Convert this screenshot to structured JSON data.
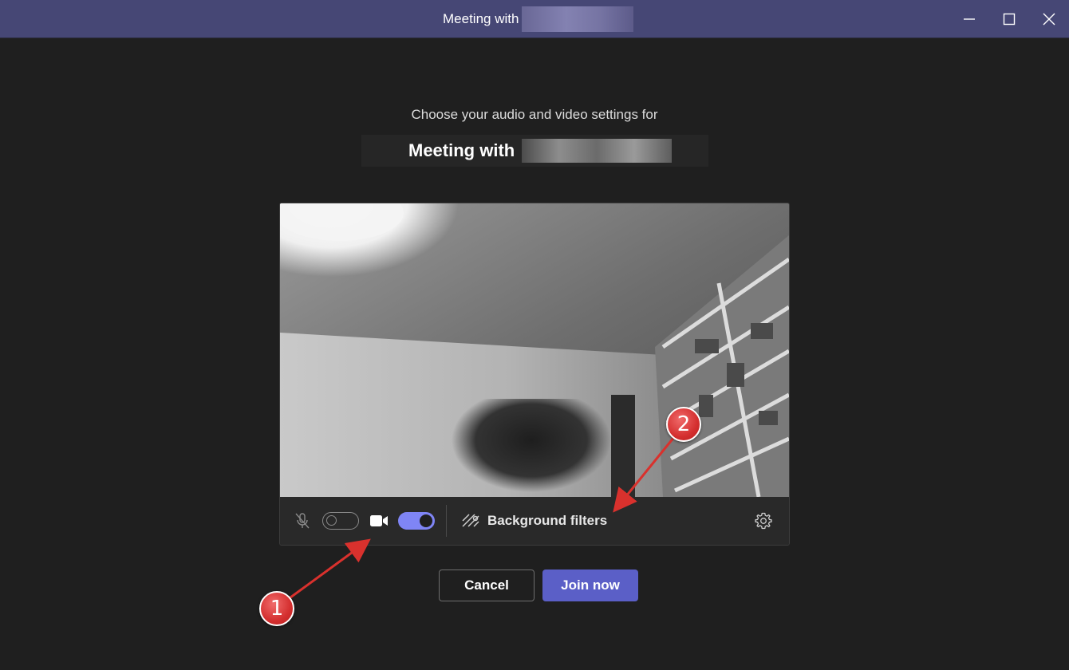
{
  "window": {
    "title": "Meeting with",
    "controls": {
      "minimize": "minimize-icon",
      "maximize": "maximize-icon",
      "close": "close-icon"
    }
  },
  "prejoin": {
    "subtitle": "Choose your audio and video settings for",
    "meeting_title": "Meeting with",
    "controls": {
      "mic_icon": "mic-off-icon",
      "mic_enabled": false,
      "camera_icon": "video-camera-icon",
      "camera_enabled": true,
      "background_filters_icon": "background-filters-icon",
      "background_filters_label": "Background filters",
      "settings_icon": "gear-icon"
    },
    "buttons": {
      "cancel": "Cancel",
      "join": "Join now"
    }
  },
  "annotations": [
    {
      "label": "1"
    },
    {
      "label": "2"
    }
  ],
  "colors": {
    "titlebar": "#464775",
    "background": "#1f1f1f",
    "accent": "#5b5fc7",
    "toggle_on": "#7f85f5",
    "annotation": "#d9312d"
  }
}
